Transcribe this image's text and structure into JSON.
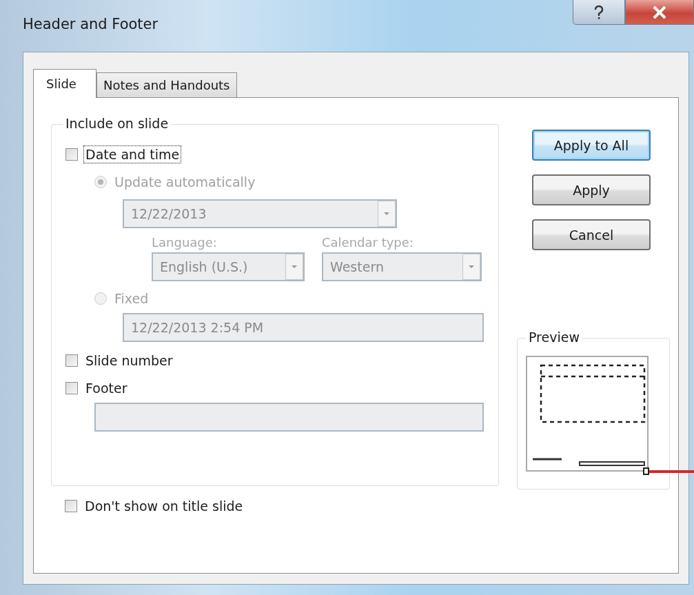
{
  "window": {
    "title": "Header and Footer"
  },
  "tabs": [
    {
      "label": "Slide",
      "selected": true
    },
    {
      "label": "Notes and Handouts",
      "selected": false
    }
  ],
  "include_group": {
    "label": "Include on slide",
    "date_and_time": {
      "label": "Date and time",
      "checked": false,
      "focused": true
    },
    "update_automatically": {
      "label": "Update automatically",
      "selected": true,
      "disabled": true
    },
    "date_format": {
      "value": "12/22/2013",
      "disabled": true
    },
    "language": {
      "label": "Language:",
      "value": "English (U.S.)",
      "disabled": true
    },
    "calendar_type": {
      "label": "Calendar type:",
      "value": "Western",
      "disabled": true
    },
    "fixed": {
      "label": "Fixed",
      "selected": false,
      "disabled": true
    },
    "fixed_value": {
      "value": "12/22/2013 2:54 PM",
      "disabled": true
    },
    "slide_number": {
      "label": "Slide number",
      "checked": false
    },
    "footer": {
      "label": "Footer",
      "checked": false
    },
    "footer_text": {
      "disabled": true
    }
  },
  "dont_show_on_title_slide": {
    "label": "Don't show on title slide",
    "checked": false
  },
  "buttons": [
    {
      "label": "Apply to All",
      "default": true
    },
    {
      "label": "Apply",
      "default": false
    },
    {
      "label": "Cancel",
      "default": false
    }
  ],
  "preview": {
    "label": "Preview"
  }
}
